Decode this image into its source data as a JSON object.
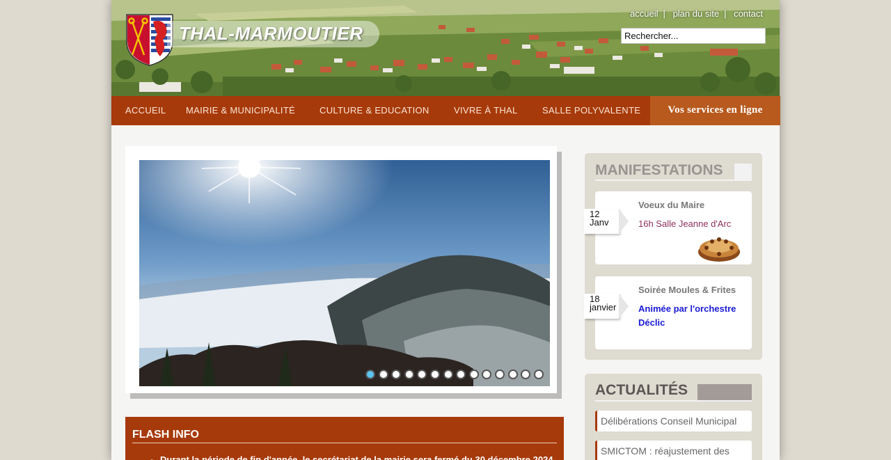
{
  "header": {
    "site_name": "THAL-MARMOUTIER",
    "links": [
      "accueil",
      "plan du site",
      "contact"
    ],
    "search_placeholder": "Rechercher..."
  },
  "nav": {
    "items": [
      "ACCUEIL",
      "MAIRIE & MUNICIPALITÉ",
      "CULTURE & EDUCATION",
      "VIVRE À THAL",
      "SALLE POLYVALENTE"
    ],
    "services": "Vos services en ligne"
  },
  "slider": {
    "active_slide": 1,
    "slide_count": 14,
    "accent": "#5bc4ee"
  },
  "flash": {
    "title": "FLASH INFO",
    "items": [
      "Durant la période de fin d'année, le secrétariat de la mairie sera fermé du 30 décembre 2024"
    ]
  },
  "manifestations": {
    "title": "MANIFESTATIONS",
    "events": [
      {
        "day": "12",
        "month": "Janv",
        "title": "Voeux du Maire",
        "desc": "16h Salle Jeanne d'Arc",
        "desc_color": "#8e2f5e"
      },
      {
        "day": "18",
        "month": "janvier",
        "title": "Soirée Moules & Frites",
        "desc": "Animée par l'orchestre Déclic",
        "desc_color": "#1a1ad6"
      }
    ]
  },
  "actualites": {
    "title": "ACTUALITÉS",
    "items": [
      "Délibérations Conseil Municipal",
      "SMICTOM : réajustement des"
    ]
  },
  "colors": {
    "brand": "#a73a0a",
    "services_bg": "#b85a1e",
    "sidebar_bg": "#dedbd1"
  }
}
